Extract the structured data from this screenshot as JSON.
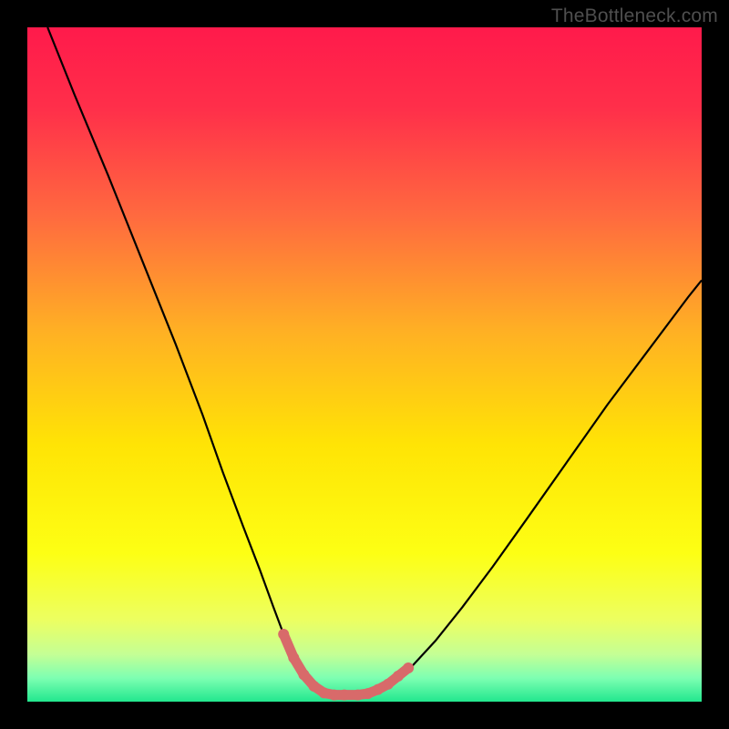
{
  "watermark": "TheBottleneck.com",
  "chart_data": {
    "type": "line",
    "title": "",
    "xlabel": "",
    "ylabel": "",
    "xlim": [
      0,
      100
    ],
    "ylim": [
      0,
      100
    ],
    "gradient_stops": [
      {
        "offset": 0.0,
        "color": "#ff1a4b"
      },
      {
        "offset": 0.12,
        "color": "#ff2f4a"
      },
      {
        "offset": 0.28,
        "color": "#ff6a3f"
      },
      {
        "offset": 0.45,
        "color": "#ffb024"
      },
      {
        "offset": 0.62,
        "color": "#ffe405"
      },
      {
        "offset": 0.78,
        "color": "#fdff14"
      },
      {
        "offset": 0.88,
        "color": "#ecff62"
      },
      {
        "offset": 0.93,
        "color": "#c4ff95"
      },
      {
        "offset": 0.965,
        "color": "#7dffb2"
      },
      {
        "offset": 1.0,
        "color": "#22e78e"
      }
    ],
    "series": [
      {
        "name": "bottleneck-curve",
        "stroke": "#000000",
        "stroke_width": 2.2,
        "x": [
          3,
          7,
          12,
          17,
          22,
          26,
          29,
          32,
          34.5,
          36.5,
          38,
          39.5,
          41,
          42.5,
          44,
          47,
          49,
          51.5,
          54,
          57,
          60.5,
          64.5,
          69,
          74,
          80,
          86,
          92,
          98,
          100
        ],
        "y": [
          100,
          90,
          78,
          65.5,
          53,
          42.5,
          34,
          26,
          19.5,
          14,
          10,
          6.5,
          4,
          2.3,
          1.3,
          1.0,
          1.0,
          1.3,
          2.6,
          5.2,
          9,
          14,
          20,
          27,
          35.5,
          44,
          52,
          60,
          62.5
        ]
      },
      {
        "name": "valley-highlight",
        "stroke": "#d86a6a",
        "stroke_width": 11,
        "linecap": "round",
        "x": [
          38,
          39.5,
          41,
          42.5,
          44,
          45.5,
          47,
          49,
          50.5,
          52,
          53.5,
          55,
          56.5
        ],
        "y": [
          10,
          6.5,
          4,
          2.3,
          1.3,
          1.0,
          1.0,
          1.0,
          1.2,
          1.8,
          2.6,
          3.8,
          5.0
        ]
      }
    ]
  }
}
